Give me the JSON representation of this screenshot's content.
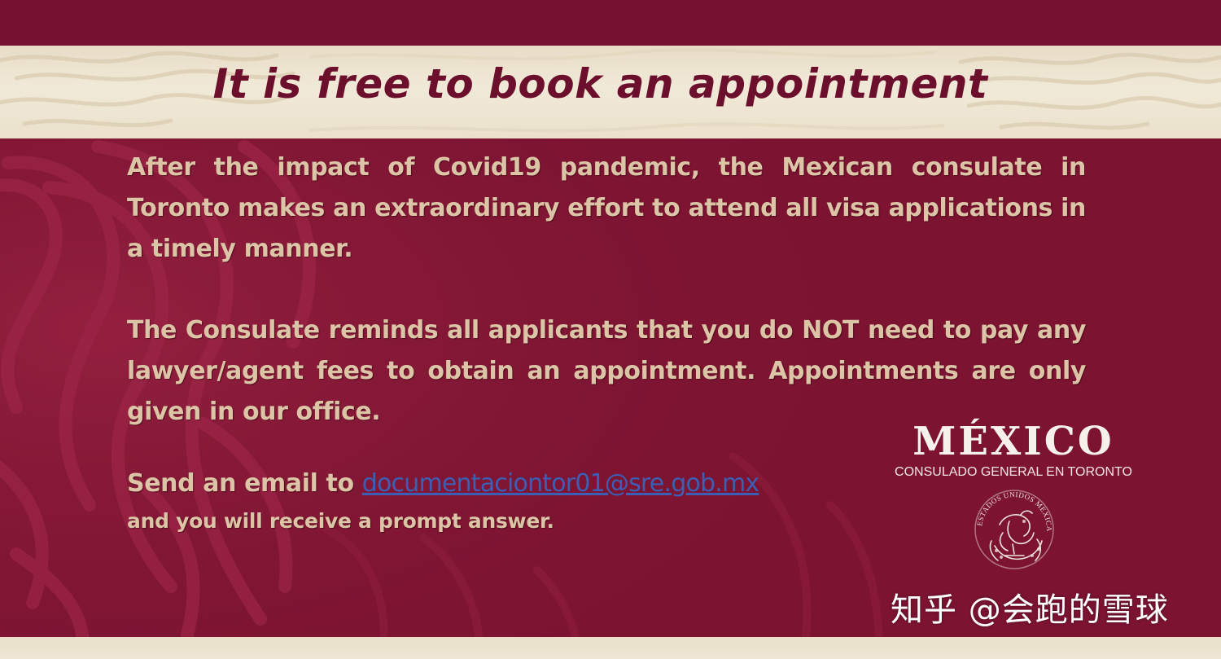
{
  "title": "It is free to book an appointment",
  "paragraphs": {
    "p1": "After the impact of Covid19 pandemic, the Mexican consulate in Toronto makes an extraordinary effort to attend all visa applications in a timely manner.",
    "p2": "The Consulate reminds all applicants that you do NOT need to pay any lawyer/agent fees to obtain an appointment. Appointments are only given in our office."
  },
  "contact": {
    "prefix": "Send an email to ",
    "email": "documentaciontor01@sre.gob.mx",
    "suffix": "and you will receive a prompt answer."
  },
  "brand": {
    "name": "MÉXICO",
    "subtitle": "CONSULADO GENERAL EN TORONTO",
    "seal_text": "ESTADOS UNIDOS MEXICANOS"
  },
  "watermark": "知乎 @会跑的雪球",
  "colors": {
    "background": "#7b1331",
    "band": "#efe6d4",
    "title": "#6b0f2c",
    "body_text": "#dcc4a6",
    "link": "#3a5fb4",
    "brand_text": "#f7f1ec"
  },
  "icons": {
    "seal": "mexican-coat-of-arms-seal"
  }
}
